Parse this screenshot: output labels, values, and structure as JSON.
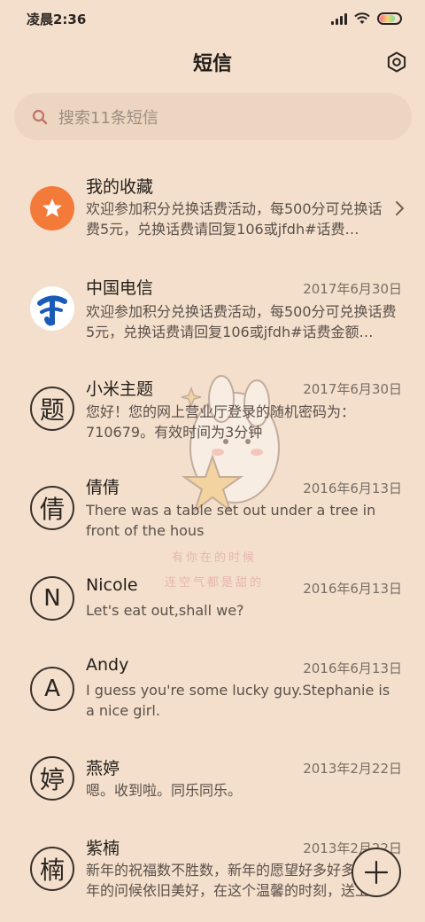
{
  "status_bar": {
    "time": "凌晨2:36",
    "battery_level": 0.75
  },
  "header": {
    "title": "短信",
    "settings_icon": "gear-icon"
  },
  "search": {
    "placeholder": "搜索11条短信",
    "icon": "search-icon"
  },
  "conversations": [
    {
      "name": "我的收藏",
      "date": "",
      "preview": "欢迎参加积分兑换话费活动，每500分可兑换话费5元，兑换话费请回复106或jfdh#话费…",
      "avatar_type": "star-icon",
      "avatar_color": "#f47a3a",
      "has_chevron": true
    },
    {
      "name": "中国电信",
      "date": "2017年6月30日",
      "preview": "欢迎参加积分兑换话费活动，每500分可兑换话费5元，兑换话费请回复106或jfdh#话费金额…",
      "avatar_type": "china-telecom-logo",
      "avatar_color": "#1a5bb8"
    },
    {
      "name": "小米主题",
      "date": "2017年6月30日",
      "preview": "您好！您的网上营业厅登录的随机密码为：710679。有效时间为3分钟",
      "avatar_letter": "题"
    },
    {
      "name": "倩倩",
      "date": "2016年6月13日",
      "preview": "There was a table set out under a tree in front of the hous",
      "avatar_letter": "倩"
    },
    {
      "name": "Nicole",
      "date": "2016年6月13日",
      "preview": "Let's eat out,shall we?",
      "avatar_letter": "N"
    },
    {
      "name": "Andy",
      "date": "2016年6月13日",
      "preview": "I guess you're some lucky guy.Stephanie is a nice girl.",
      "avatar_letter": "A"
    },
    {
      "name": "燕婷",
      "date": "2013年2月22日",
      "preview": "嗯。收到啦。同乐同乐。",
      "avatar_letter": "婷"
    },
    {
      "name": "紫楠",
      "date": "2013年2月22日",
      "preview": "新年的祝福数不胜数，新年的愿望好多好多，新年的问候依旧美好，在这个温馨的时刻，送上…",
      "avatar_letter": "楠"
    }
  ],
  "sticker": {
    "line1": "有你在的时候",
    "line2": "连空气都是甜的"
  },
  "fab": {
    "icon": "plus-icon"
  }
}
